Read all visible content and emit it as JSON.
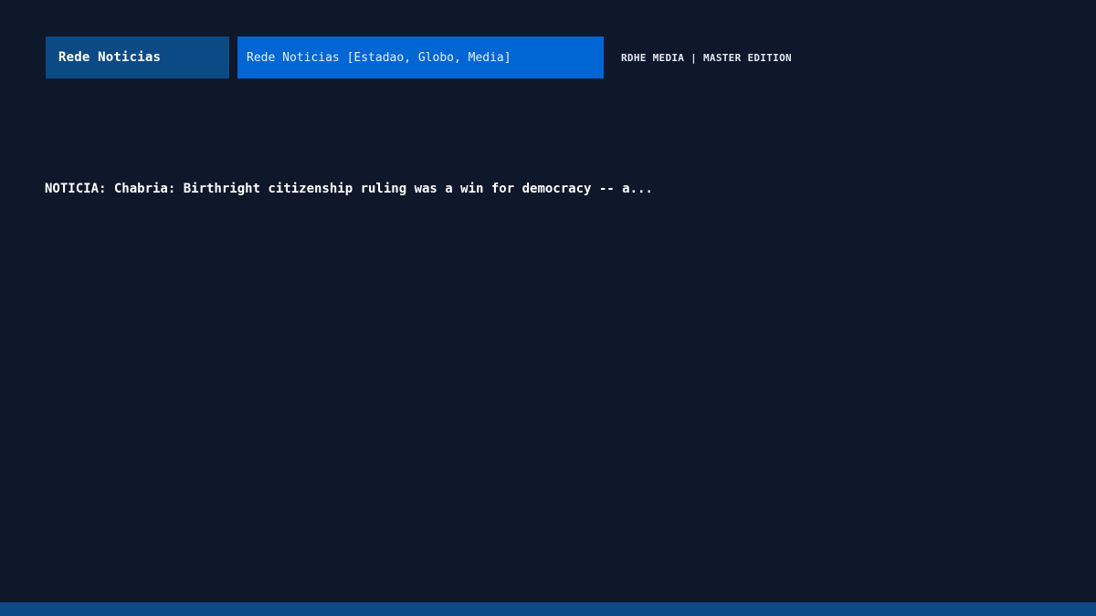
{
  "header": {
    "channel_label": "Rede Noticias",
    "sources_label": "Rede Noticias [Estadao, Globo, Media]",
    "brand_label": "RDHE MEDIA | MASTER EDITION"
  },
  "main": {
    "headline": "NOTICIA: Chabria: Birthright citizenship ruling was a win for democracy -- a..."
  },
  "colors": {
    "background": "#0f172a",
    "channel_button": "#0c4a86",
    "source_field": "#0066d4",
    "bottom_bar": "#0c4a86",
    "text": "#ffffff"
  }
}
